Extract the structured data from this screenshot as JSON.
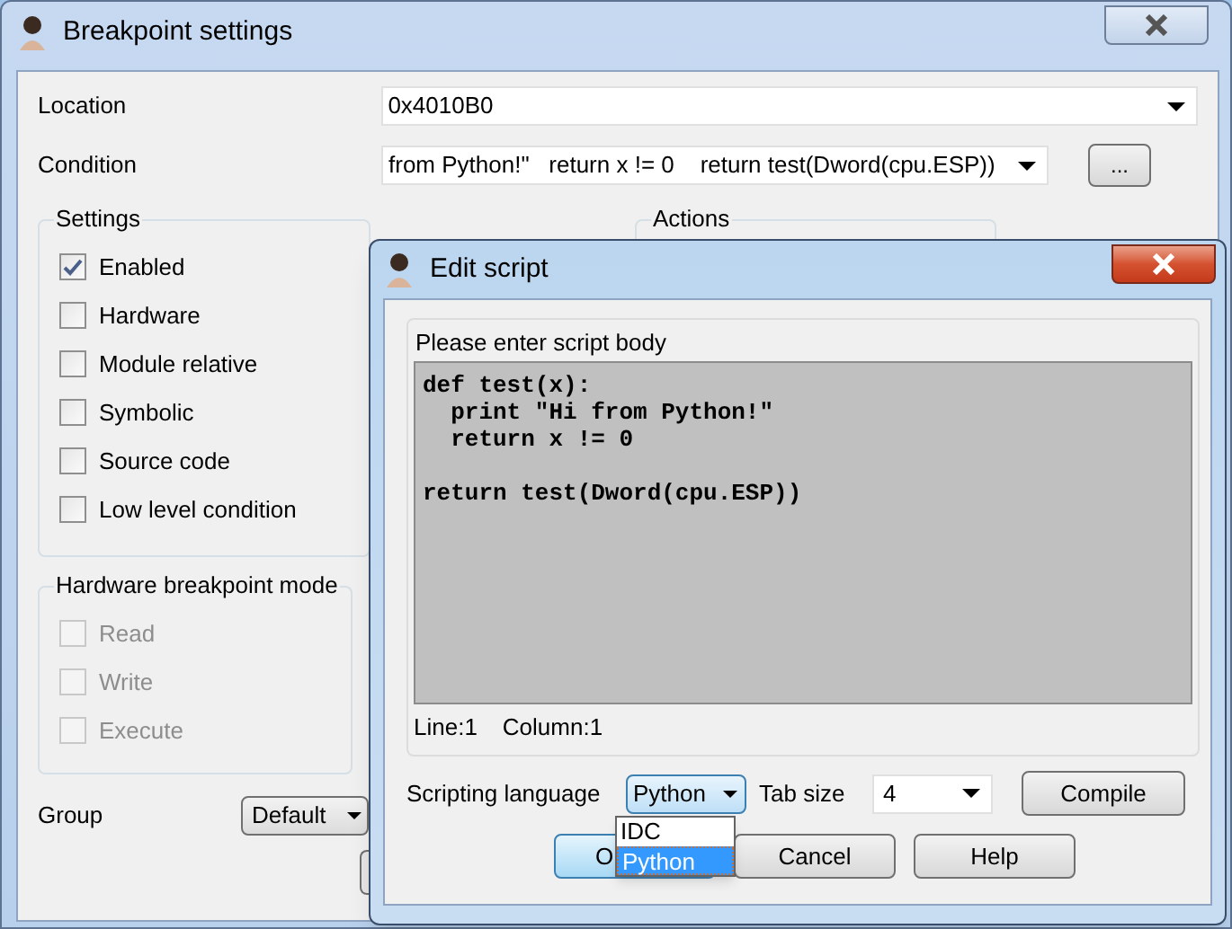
{
  "main_window": {
    "title": "Breakpoint settings",
    "fields": [
      {
        "kind": "combo",
        "label": "Location",
        "value": "0x4010B0"
      },
      {
        "kind": "combo_button",
        "label": "Condition",
        "value": "from Python!\"   return x != 0    return test(Dword(cpu.ESP))",
        "button": "..."
      }
    ],
    "settings": {
      "title": "Settings",
      "items": [
        {
          "label": "Enabled",
          "checked": true,
          "disabled": false
        },
        {
          "label": "Hardware",
          "checked": false,
          "disabled": false
        },
        {
          "label": "Module relative",
          "checked": false,
          "disabled": false
        },
        {
          "label": "Symbolic",
          "checked": false,
          "disabled": false
        },
        {
          "label": "Source code",
          "checked": false,
          "disabled": false
        },
        {
          "label": "Low level condition",
          "checked": false,
          "disabled": false
        }
      ]
    },
    "actions": {
      "title": "Actions"
    },
    "hardware_mode": {
      "title": "Hardware breakpoint mode",
      "items": [
        {
          "label": "Read",
          "checked": false,
          "disabled": true
        },
        {
          "label": "Write",
          "checked": false,
          "disabled": true
        },
        {
          "label": "Execute",
          "checked": false,
          "disabled": true
        }
      ]
    },
    "group": {
      "label": "Group",
      "value": "Default"
    }
  },
  "edit_script": {
    "title": "Edit script",
    "prompt": "Please enter script body",
    "code": "def test(x):\n  print \"Hi from Python!\"\n  return x != 0\n\nreturn test(Dword(cpu.ESP))",
    "status": [
      "Line:1",
      "Column:1"
    ],
    "language": {
      "label": "Scripting language",
      "value": "Python",
      "expanded": true,
      "options": [
        {
          "label": "IDC",
          "selected": false
        },
        {
          "label": "Python",
          "selected": true
        }
      ]
    },
    "tab_size": {
      "label": "Tab size",
      "value": "4"
    },
    "compile": "Compile",
    "buttons": [
      {
        "label": "O",
        "default": true
      },
      {
        "label": "Cancel",
        "default": false
      },
      {
        "label": "Help",
        "default": false
      }
    ]
  }
}
